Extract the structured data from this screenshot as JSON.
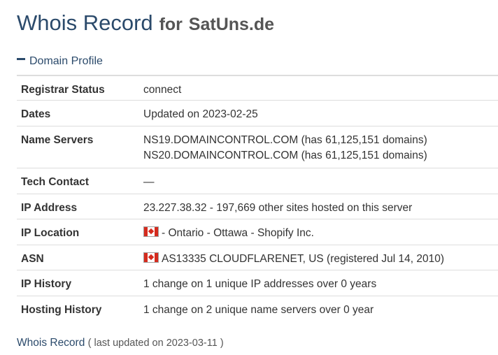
{
  "header": {
    "title": "Whois Record",
    "for": "for",
    "domain": "SatUns.de"
  },
  "section": {
    "label": "Domain Profile",
    "icon": "collapse-icon"
  },
  "rows": {
    "registrar_status": {
      "label": "Registrar Status",
      "value": "connect"
    },
    "dates": {
      "label": "Dates",
      "value": "Updated on 2023-02-25"
    },
    "name_servers": {
      "label": "Name Servers",
      "ns1": "NS19.DOMAINCONTROL.COM (has 61,125,151 domains)",
      "ns2": "NS20.DOMAINCONTROL.COM (has 61,125,151 domains)"
    },
    "tech_contact": {
      "label": "Tech Contact",
      "value": "—"
    },
    "ip_address": {
      "label": "IP Address",
      "value": "23.227.38.32 - 197,669 other sites hosted on this server"
    },
    "ip_location": {
      "label": "IP Location",
      "value": "- Ontario - Ottawa - Shopify Inc.",
      "flag": "canada-flag-icon"
    },
    "asn": {
      "label": "ASN",
      "value": "AS13335 CLOUDFLARENET, US (registered Jul 14, 2010)",
      "flag": "canada-flag-icon"
    },
    "ip_history": {
      "label": "IP History",
      "value": "1 change on 1 unique IP addresses over 0 years"
    },
    "hosting_history": {
      "label": "Hosting History",
      "value": "1 change on 2 unique name servers over 0 year"
    }
  },
  "footer": {
    "link": "Whois Record",
    "updated": "( last updated on 2023-03-11 )"
  },
  "colors": {
    "heading": "#2b4a6b",
    "text": "#333333",
    "border": "#dddddd",
    "flag_red": "#d52b1e"
  }
}
